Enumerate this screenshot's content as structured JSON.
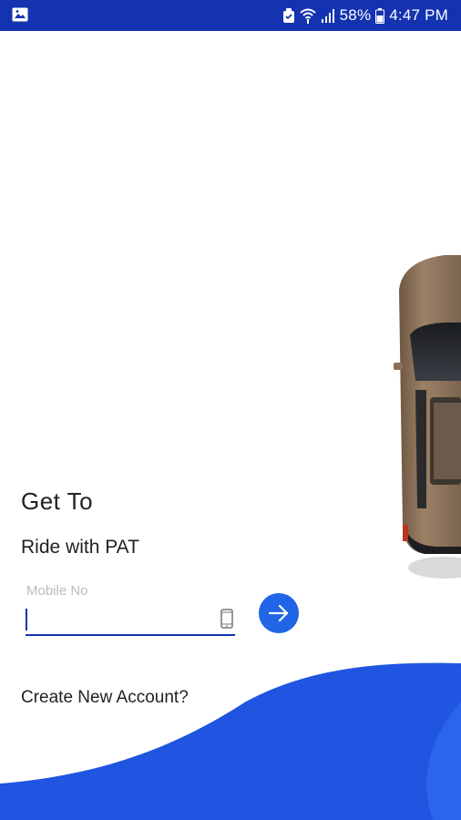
{
  "status_bar": {
    "battery_percent": "58%",
    "time": "4:47 PM",
    "icons": [
      "gallery-icon",
      "shield-icon",
      "wifi-icon",
      "signal-icon",
      "battery-icon"
    ]
  },
  "hero": {
    "image": "car-top-view"
  },
  "login": {
    "title": "Get To",
    "subtitle": "Ride with PAT",
    "mobile_label": "Mobile No",
    "mobile_value": "",
    "field_icon": "phone-icon",
    "submit_icon": "arrow-right-icon"
  },
  "footer": {
    "create_account": "Create New Account?"
  },
  "colors": {
    "primary": "#1533b0",
    "accent": "#2065e6",
    "wave": "#1f55e0"
  }
}
